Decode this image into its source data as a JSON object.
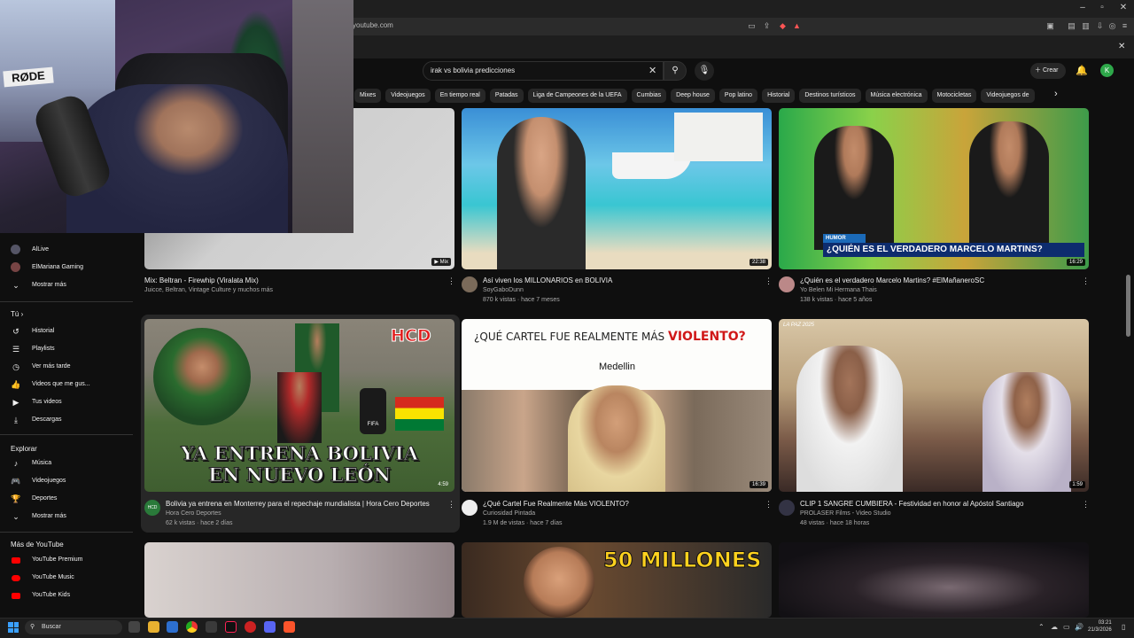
{
  "browser": {
    "url": "youtube.com",
    "window_controls": [
      "–",
      "▫",
      "✕"
    ]
  },
  "header": {
    "search_query": "irak vs bolivia predicciones",
    "create_label": "Crear",
    "avatar_letter": "K"
  },
  "chips": [
    "Mixes",
    "Videojuegos",
    "En tiempo real",
    "Patadas",
    "Liga de Campeones de la UEFA",
    "Cumbias",
    "Deep house",
    "Pop latino",
    "Historial",
    "Destinos turísticos",
    "Música electrónica",
    "Motocicletas",
    "Videojuegos de"
  ],
  "webcam": {
    "brand": "RØDE"
  },
  "sidebar": {
    "subs": [
      {
        "label": "AlLive",
        "icon": "channel-avatar"
      },
      {
        "label": "ElMariana Gaming",
        "icon": "channel-avatar"
      },
      {
        "label": "Mostrar más",
        "icon": "chevron-down-icon"
      }
    ],
    "you_title": "Tú",
    "you_items": [
      {
        "label": "Historial",
        "icon": "history-icon"
      },
      {
        "label": "Playlists",
        "icon": "playlist-icon"
      },
      {
        "label": "Ver más tarde",
        "icon": "clock-icon"
      },
      {
        "label": "Videos que me gus...",
        "icon": "like-icon"
      },
      {
        "label": "Tus videos",
        "icon": "video-icon"
      },
      {
        "label": "Descargas",
        "icon": "download-icon"
      }
    ],
    "explore_title": "Explorar",
    "explore_items": [
      {
        "label": "Música",
        "icon": "music-icon"
      },
      {
        "label": "Videojuegos",
        "icon": "gamepad-icon"
      },
      {
        "label": "Deportes",
        "icon": "trophy-icon"
      },
      {
        "label": "Mostrar más",
        "icon": "chevron-down-icon"
      }
    ],
    "more_title": "Más de YouTube",
    "more_items": [
      {
        "label": "YouTube Premium"
      },
      {
        "label": "YouTube Music"
      },
      {
        "label": "YouTube Kids"
      }
    ]
  },
  "videos": [
    {
      "title": "Mix: Beltran - Firewhip (Viralata Mix)",
      "channel": "Juicce, Beltran, Vintage Culture y muchos más",
      "meta": "",
      "duration": "Mix",
      "thumb_text": ""
    },
    {
      "title": "Así viven los MILLONARIOS en BOLIVIA",
      "channel": "SoyGaboDunn",
      "meta": "870 k vistas · hace 7 meses",
      "duration": "22:38",
      "thumb_text": ""
    },
    {
      "title": "¿Quién es el verdadero Marcelo Martins? #ElMañaneroSC",
      "channel": "Yo Belen Mi Hermana Thais",
      "meta": "138 k vistas · hace 5 años",
      "duration": "16:29",
      "thumb_text": "¿QUIÉN ES EL VERDADERO MARCELO MARTINS?",
      "thumb_tag": "HUMOR"
    },
    {
      "title": "Bolivia ya entrena en Monterrey para el repechaje mundialista | Hora Cero Deportes",
      "channel": "Hora Cero Deportes",
      "meta": "62 k vistas · hace 2 días",
      "duration": "4:59",
      "thumb_text": "YA ENTRENA BOLIVIA EN NUEVO LEÓN",
      "thumb_tag": "HCD"
    },
    {
      "title": "¿Qué Cartel Fue Realmente Más VIOLENTO?",
      "channel": "Curiosidad Pintada",
      "meta": "1.9 M de vistas · hace 7 días",
      "duration": "16:39",
      "thumb_text": "¿QUÉ CARTEL FUE REALMENTE MÁS",
      "thumb_tag": "VIOLENTO?"
    },
    {
      "title": "CLIP 1 SANGRE CUMBIERA - Festividad en honor al Apóstol Santiago",
      "channel": "PROLASER Films - Video Studio",
      "meta": "48 vistas · hace 18 horas",
      "duration": "1:59",
      "thumb_text": "LA PAZ 2025"
    },
    {
      "thumb_text": ""
    },
    {
      "thumb_text": "50 MILLONES"
    },
    {
      "thumb_text": ""
    }
  ],
  "taskbar": {
    "search_label": "Buscar",
    "time": "03:21",
    "date": "21/3/2026"
  }
}
